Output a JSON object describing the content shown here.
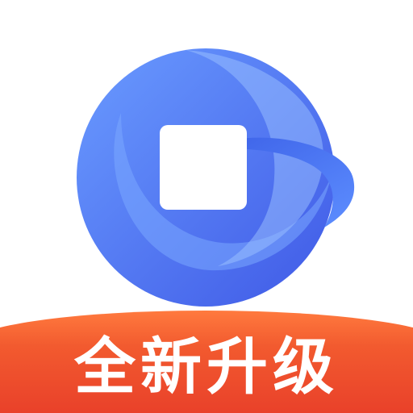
{
  "icon": {
    "name": "app-logo-globe-icon",
    "colors": {
      "primary_blue": "#4f7cf5",
      "dark_blue": "#3f5fe0",
      "light_blue": "#6ea3ff",
      "banner_red": "#f0482c",
      "banner_orange": "#ff6f3c"
    }
  },
  "banner": {
    "label": "全新升级"
  }
}
